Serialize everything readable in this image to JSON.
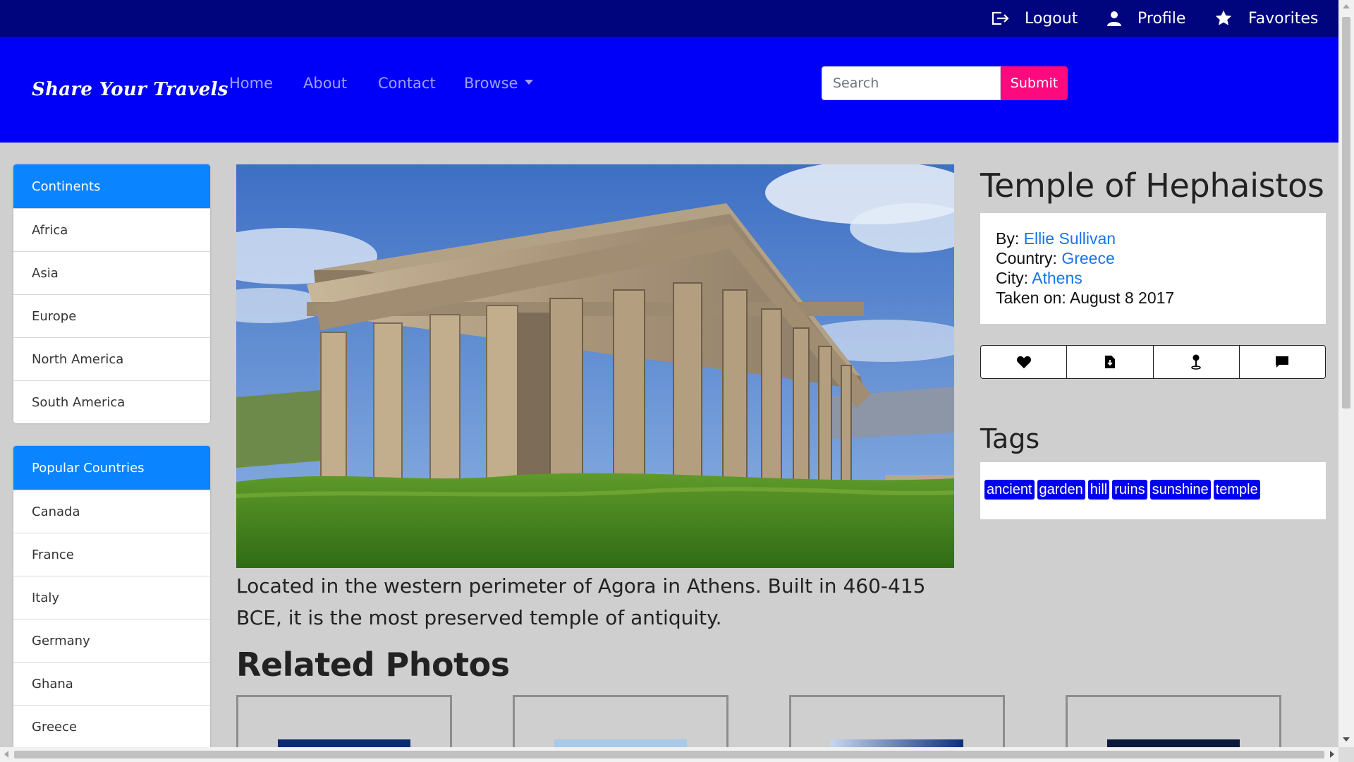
{
  "top_links": {
    "logout": "Logout",
    "profile": "Profile",
    "favorites": "Favorites"
  },
  "navbar": {
    "brand": "Share Your Travels",
    "home": "Home",
    "about": "About",
    "contact": "Contact",
    "browse": "Browse",
    "search_placeholder": "Search",
    "submit": "Submit"
  },
  "sidebar": {
    "continents_header": "Continents",
    "continents": [
      "Africa",
      "Asia",
      "Europe",
      "North America",
      "South America"
    ],
    "countries_header": "Popular Countries",
    "countries": [
      "Canada",
      "France",
      "Italy",
      "Germany",
      "Ghana",
      "Greece"
    ]
  },
  "photo": {
    "title": "Temple of Hephaistos",
    "by_label": "By:",
    "by": "Ellie Sullivan",
    "country_label": "Country:",
    "country": "Greece",
    "city_label": "City:",
    "city": "Athens",
    "taken_label": "Taken on:",
    "taken": "August 8 2017",
    "description": "Located in the western perimeter of Agora in Athens. Built in 460-415 BCE, it is the most preserved temple of antiquity."
  },
  "actions": {
    "icons": [
      "heart-icon",
      "file-download-icon",
      "map-pin-icon",
      "comment-icon"
    ]
  },
  "tags": {
    "title": "Tags",
    "items": [
      "ancient",
      "garden",
      "hill",
      "ruins",
      "sunshine",
      "temple"
    ]
  },
  "related": {
    "title": "Related Photos"
  },
  "colors": {
    "topbar": "#00057d",
    "navbar": "#0000f8",
    "list_header": "#0a84ff",
    "submit": "#ff0a7e",
    "tag": "#0000f0",
    "link": "#1a73e8"
  }
}
